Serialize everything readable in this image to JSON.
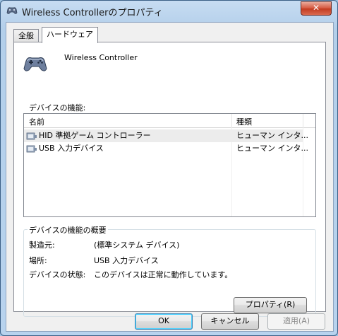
{
  "window": {
    "title": "Wireless Controllerのプロパティ",
    "close_label": "✕"
  },
  "tabs": [
    {
      "label": "全般",
      "selected": false
    },
    {
      "label": "ハードウェア",
      "selected": true
    }
  ],
  "device": {
    "name": "Wireless Controller"
  },
  "functions": {
    "label": "デバイスの機能:",
    "columns": [
      "名前",
      "種類"
    ],
    "rows": [
      {
        "name": "HID 準拠ゲーム コントローラー",
        "type": "ヒューマン インタ...",
        "selected": true
      },
      {
        "name": "USB 入力デバイス",
        "type": "ヒューマン インタ...",
        "selected": false
      }
    ]
  },
  "summary": {
    "title": "デバイスの機能の概要",
    "manufacturer_label": "製造元:",
    "manufacturer_value": "(標準システム デバイス)",
    "location_label": "場所:",
    "location_value": "USB 入力デバイス",
    "status_label": "デバイスの状態:",
    "status_value": "このデバイスは正常に動作しています。",
    "properties_button": "プロパティ(R)"
  },
  "footer": {
    "ok": "OK",
    "cancel": "キャンセル",
    "apply": "適用(A)"
  }
}
